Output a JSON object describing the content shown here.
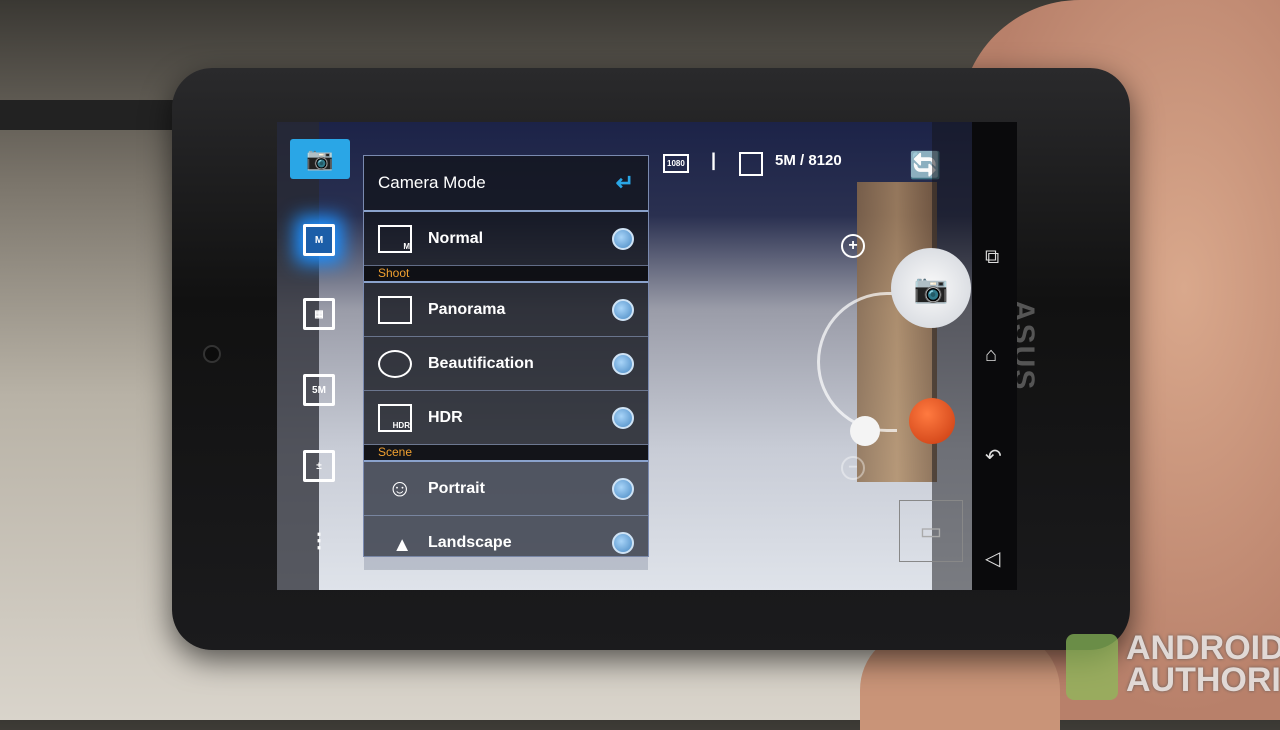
{
  "device": {
    "brand": "ASUS"
  },
  "watermark": {
    "line1": "ANDROID",
    "line2": "AUTHORITY"
  },
  "camera_mode_panel": {
    "title": "Camera Mode",
    "back_icon": "back-arrow-icon",
    "items": [
      {
        "label": "Normal",
        "icon_text": "M",
        "section": null
      },
      {
        "label": "Panorama",
        "icon_text": "",
        "section": "Shoot"
      },
      {
        "label": "Beautification",
        "icon_text": "",
        "section": "Shoot"
      },
      {
        "label": "HDR",
        "icon_text": "HDR",
        "section": "Shoot"
      },
      {
        "label": "Portrait",
        "icon_text": "",
        "section": "Scene"
      },
      {
        "label": "Landscape",
        "icon_text": "",
        "section": "Scene"
      }
    ],
    "sections": {
      "shoot": "Shoot",
      "scene": "Scene"
    }
  },
  "left_toolbar": {
    "items": [
      {
        "name": "camera-mode",
        "icon": "camera-settings-icon"
      },
      {
        "name": "normal-mode",
        "icon": "normal-mode-icon",
        "active": true
      },
      {
        "name": "white-balance",
        "icon": "white-balance-icon"
      },
      {
        "name": "resolution",
        "icon": "resolution-icon",
        "text": "5M"
      },
      {
        "name": "exposure",
        "icon": "exposure-icon"
      },
      {
        "name": "more",
        "icon": "more-icon"
      }
    ]
  },
  "status_bar": {
    "video_res": "1080",
    "resolution_count": "5M / 8120"
  },
  "colors": {
    "accent": "#2aa6e6",
    "section": "#f0a030",
    "record": "#e04a18"
  }
}
